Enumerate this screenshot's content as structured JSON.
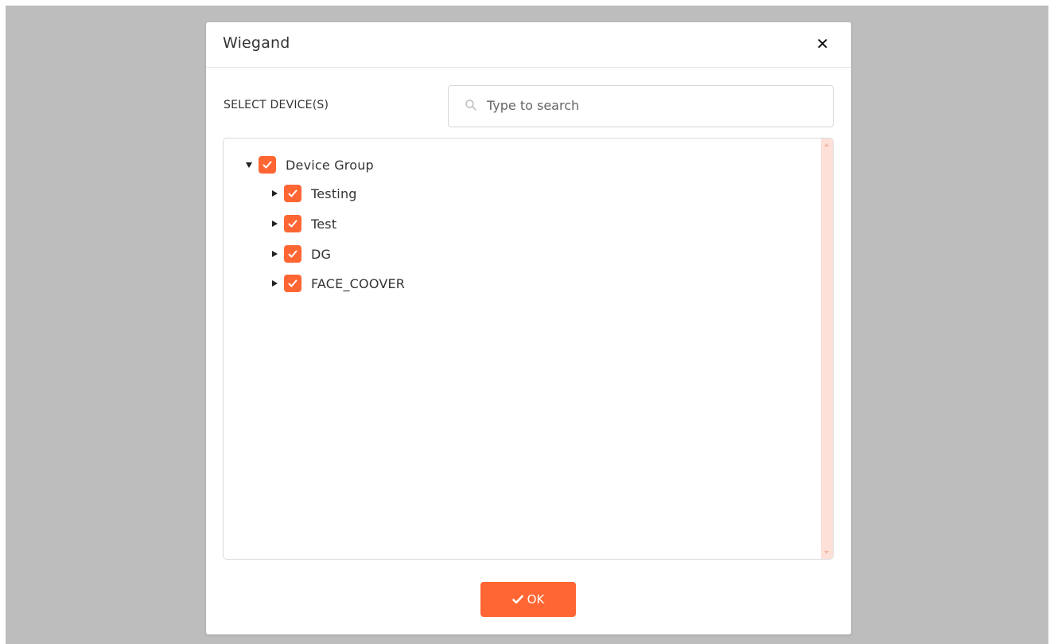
{
  "dialog": {
    "title": "Wiegand",
    "close_icon": "close-icon"
  },
  "device_select": {
    "label": "SELECT DEVICE(S)",
    "search": {
      "placeholder": "Type to search",
      "value": "",
      "icon": "search-icon"
    }
  },
  "tree": {
    "root": {
      "label": "Device Group",
      "expanded": true,
      "checked": true
    },
    "children": [
      {
        "label": "Testing",
        "expanded": false,
        "checked": true
      },
      {
        "label": "Test",
        "expanded": false,
        "checked": true
      },
      {
        "label": "DG",
        "expanded": false,
        "checked": true
      },
      {
        "label": "FACE_COOVER",
        "expanded": false,
        "checked": true
      }
    ]
  },
  "footer": {
    "ok_label": "OK",
    "ok_icon": "check-icon"
  },
  "colors": {
    "accent": "#ff6633",
    "overlay": "#bdbdbd",
    "scrollbar_track": "#fde0d8"
  }
}
